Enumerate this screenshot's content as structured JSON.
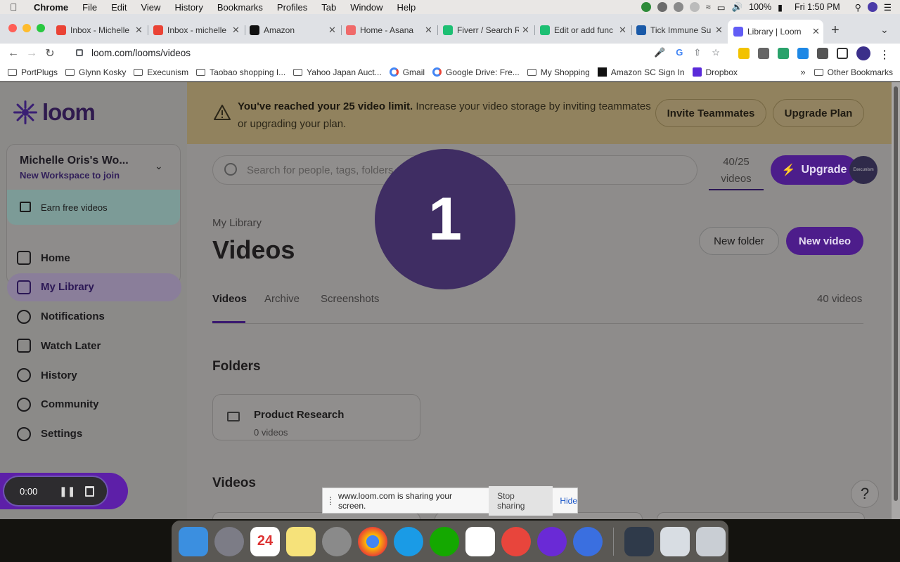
{
  "menubar": {
    "app": "Chrome",
    "items": [
      "File",
      "Edit",
      "View",
      "History",
      "Bookmarks",
      "Profiles",
      "Tab",
      "Window",
      "Help"
    ],
    "battery": "100%",
    "clock": "Fri 1:50 PM"
  },
  "tabs": [
    {
      "title": "Inbox - Michelle",
      "color": "#ea4335"
    },
    {
      "title": "Inbox - michelle",
      "color": "#ea4335"
    },
    {
      "title": "Amazon",
      "color": "#111111"
    },
    {
      "title": "Home - Asana",
      "color": "#f06a6a"
    },
    {
      "title": "Fiverr / Search R",
      "color": "#1dbf73"
    },
    {
      "title": "Edit or add func",
      "color": "#1dbf73"
    },
    {
      "title": "Tick Immune Su",
      "color": "#1a5aa8"
    },
    {
      "title": "Library | Loom",
      "color": "#625df5"
    }
  ],
  "url": "loom.com/looms/videos",
  "bookmarks": [
    "PortPlugs",
    "Glynn Kosky",
    "Execunism",
    "Taobao shopping I...",
    "Yahoo Japan Auct...",
    "Gmail",
    "Google Drive: Fre...",
    "My Shopping",
    "Amazon SC Sign In",
    "Dropbox"
  ],
  "bookmarks_more": "»",
  "other_bookmarks": "Other Bookmarks",
  "sidebar": {
    "logo": "loom",
    "workspace_name": "Michelle Oris's Wo...",
    "workspace_sub": "New Workspace to join",
    "earn": "Earn free videos",
    "nav": [
      "Home",
      "My Library",
      "Notifications",
      "Watch Later",
      "History",
      "Community",
      "Settings"
    ]
  },
  "banner": {
    "bold": "You've reached your 25 video limit.",
    "text": " Increase your video storage by inviting teammates or upgrading your plan.",
    "invite": "Invite Teammates",
    "upgrade_plan": "Upgrade Plan"
  },
  "main": {
    "search_placeholder": "Search for people, tags, folders, Spaces, and Looms",
    "count_line1": "40/25",
    "count_line2": "videos",
    "upgrade": "Upgrade",
    "avatar_text": "Execunism",
    "breadcrumb": "My Library",
    "title": "Videos",
    "new_folder": "New folder",
    "new_video": "New video",
    "tabs": [
      "Videos",
      "Archive",
      "Screenshots"
    ],
    "video_count": "40 videos",
    "folders_heading": "Folders",
    "folder_name": "Product Research",
    "folder_sub": "0 videos",
    "videos_heading": "Videos"
  },
  "recorder": {
    "time": "0:00"
  },
  "countdown": "1",
  "share_bar": {
    "text": "www.loom.com is sharing your screen.",
    "stop": "Stop sharing",
    "hide": "Hide"
  },
  "help": "?",
  "calendar": {
    "day": "24",
    "month": "FEB"
  },
  "accent": "#625df5"
}
